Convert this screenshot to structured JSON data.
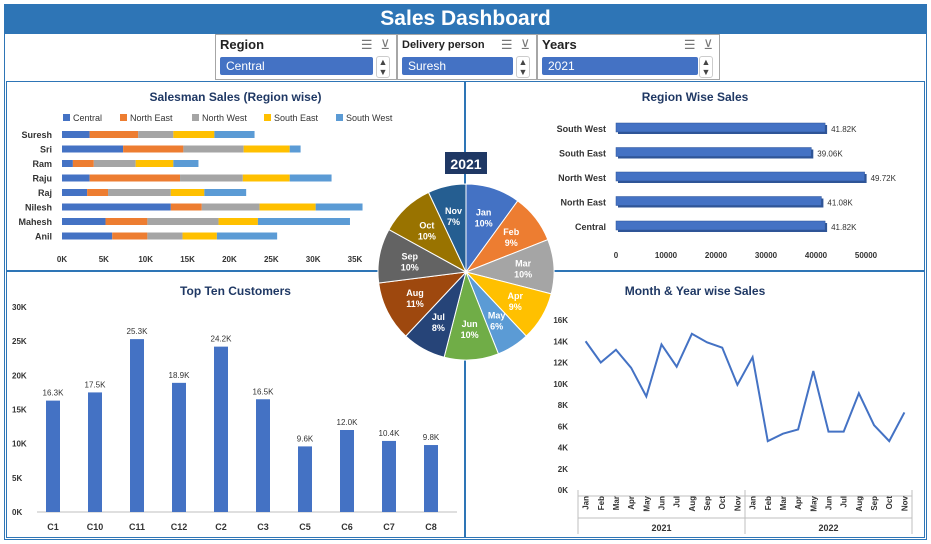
{
  "title": "Sales Dashboard",
  "slicers": [
    {
      "header": "Region",
      "value": "Central"
    },
    {
      "header": "Delivery person",
      "value": "Suresh"
    },
    {
      "header": "Years",
      "value": "2021"
    }
  ],
  "chart_data": [
    {
      "type": "bar",
      "title": "Salesman Sales (Region wise)",
      "stacked": true,
      "orientation": "horizontal",
      "categories": [
        "Suresh",
        "Sri",
        "Ram",
        "Raju",
        "Raj",
        "Nilesh",
        "Mahesh",
        "Anil"
      ],
      "series": [
        {
          "name": "Central",
          "color": "#4472c4",
          "values": [
            3300,
            7300,
            1300,
            3300,
            3000,
            13000,
            5200,
            6000
          ]
        },
        {
          "name": "North East",
          "color": "#ed7d31",
          "values": [
            5800,
            7200,
            2500,
            10800,
            2500,
            3700,
            5000,
            4200
          ]
        },
        {
          "name": "North West",
          "color": "#a5a5a5",
          "values": [
            4200,
            7200,
            5000,
            7500,
            7500,
            6900,
            8500,
            4200
          ]
        },
        {
          "name": "South East",
          "color": "#ffc000",
          "values": [
            4900,
            5500,
            4500,
            5600,
            4000,
            6700,
            4700,
            4100
          ]
        },
        {
          "name": "South West",
          "color": "#5b9bd5",
          "values": [
            4800,
            1300,
            3000,
            5000,
            5000,
            5600,
            11000,
            7200
          ]
        }
      ],
      "xticks": [
        "0K",
        "5K",
        "10K",
        "15K",
        "20K",
        "25K",
        "30K",
        "35K"
      ],
      "xlim": [
        0,
        35000
      ]
    },
    {
      "type": "bar",
      "title": "Region Wise Sales",
      "orientation": "horizontal",
      "categories": [
        "South West",
        "South East",
        "North West",
        "North East",
        "Central"
      ],
      "values": [
        41820,
        39060,
        49720,
        41080,
        41820
      ],
      "labels": [
        "41.82K",
        "39.06K",
        "49.72K",
        "41.08K",
        "41.82K"
      ],
      "xticks": [
        "0",
        "10000",
        "20000",
        "30000",
        "40000",
        "50000"
      ],
      "xlim": [
        0,
        55000
      ],
      "color": "#4472c4"
    },
    {
      "type": "pie",
      "title": "2021",
      "categories": [
        "Jan",
        "Feb",
        "Mar",
        "Apr",
        "May",
        "Jun",
        "Jul",
        "Aug",
        "Sep",
        "Oct",
        "Nov"
      ],
      "values": [
        10,
        9,
        10,
        9,
        6,
        10,
        8,
        11,
        10,
        10,
        7
      ],
      "labels": [
        "10%",
        "9%",
        "10%",
        "9%",
        "6%",
        "10%",
        "8%",
        "11%",
        "10%",
        "10%",
        "7%"
      ],
      "colors": [
        "#4472c4",
        "#ed7d31",
        "#a5a5a5",
        "#ffc000",
        "#5b9bd5",
        "#70ad47",
        "#264478",
        "#9e480e",
        "#636363",
        "#997300",
        "#255e91"
      ]
    },
    {
      "type": "bar",
      "title": "Top Ten Customers",
      "categories": [
        "C1",
        "C10",
        "C11",
        "C12",
        "C2",
        "C3",
        "C5",
        "C6",
        "C7",
        "C8"
      ],
      "values": [
        16300,
        17500,
        25300,
        18900,
        24200,
        16500,
        9600,
        12000,
        10400,
        9800
      ],
      "labels": [
        "16.3K",
        "17.5K",
        "25.3K",
        "18.9K",
        "24.2K",
        "16.5K",
        "9.6K",
        "12.0K",
        "10.4K",
        "9.8K"
      ],
      "yticks": [
        "0K",
        "5K",
        "10K",
        "15K",
        "20K",
        "25K",
        "30K"
      ],
      "ylim": [
        0,
        30000
      ],
      "color": "#4472c4"
    },
    {
      "type": "line",
      "title": "Month & Year wise Sales",
      "months": [
        "Jan",
        "Feb",
        "Mar",
        "Apr",
        "May",
        "Jun",
        "Jul",
        "Aug",
        "Sep",
        "Oct",
        "Nov"
      ],
      "groups": [
        "2021",
        "2022"
      ],
      "values": [
        14000,
        12000,
        13200,
        11500,
        8800,
        13700,
        11600,
        14700,
        13900,
        13400,
        9900,
        12500,
        4600,
        5300,
        5700,
        11200,
        5500,
        5500,
        9100,
        6100,
        4600,
        7300
      ],
      "yticks": [
        "0K",
        "2K",
        "4K",
        "6K",
        "8K",
        "10K",
        "12K",
        "14K",
        "16K"
      ],
      "ylim": [
        0,
        16000
      ],
      "color": "#4472c4"
    }
  ]
}
